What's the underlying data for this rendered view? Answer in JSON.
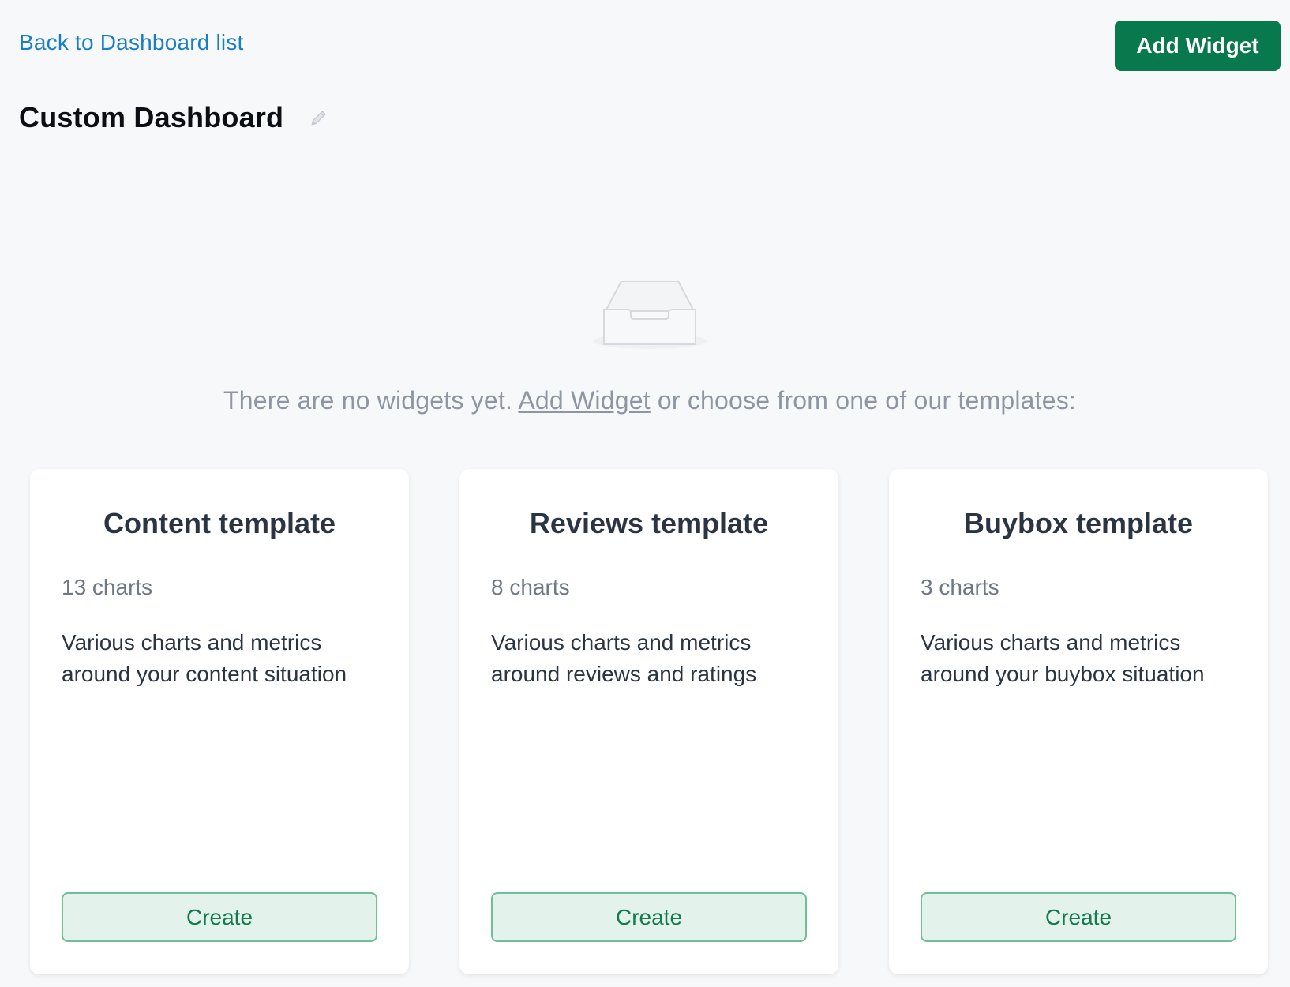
{
  "header": {
    "back_link": "Back to Dashboard list",
    "add_widget_label": "Add Widget"
  },
  "page": {
    "title": "Custom Dashboard"
  },
  "empty_state": {
    "text_before": "There are no widgets yet.",
    "link_label": "Add Widget",
    "text_after": "or choose from one of our templates:"
  },
  "templates": [
    {
      "title": "Content template",
      "count": "13 charts",
      "description": "Various charts and metrics around your content situation",
      "button_label": "Create"
    },
    {
      "title": "Reviews template",
      "count": "8 charts",
      "description": "Various charts and metrics around reviews and ratings",
      "button_label": "Create"
    },
    {
      "title": "Buybox template",
      "count": "3 charts",
      "description": "Various charts and metrics around your buybox situation",
      "button_label": "Create"
    }
  ],
  "colors": {
    "primary": "#08794d",
    "link": "#1a7fc1",
    "background": "#f7f8fa",
    "create_bg": "#e3f3eb",
    "create_border": "#6fbf98"
  },
  "icons": {
    "edit": "pencil-icon",
    "empty": "empty-inbox-icon"
  }
}
